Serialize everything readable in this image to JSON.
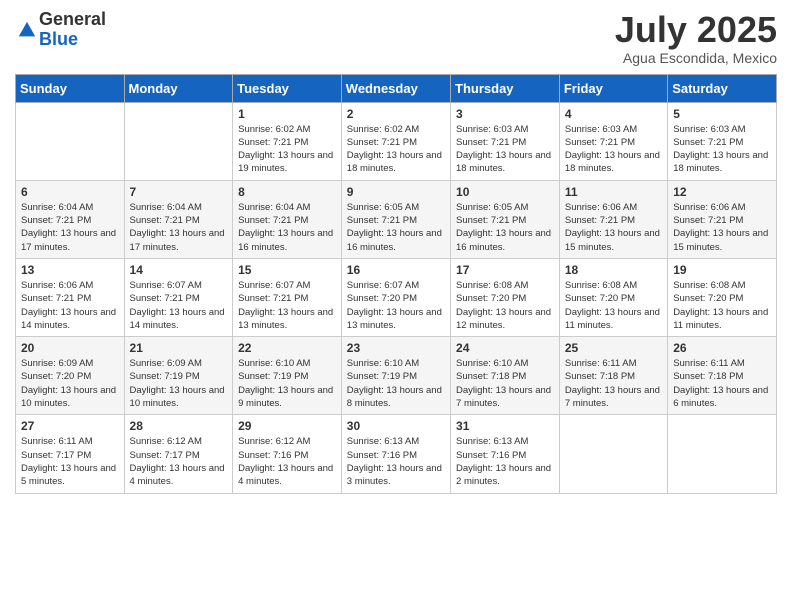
{
  "header": {
    "logo_general": "General",
    "logo_blue": "Blue",
    "month": "July 2025",
    "location": "Agua Escondida, Mexico"
  },
  "weekdays": [
    "Sunday",
    "Monday",
    "Tuesday",
    "Wednesday",
    "Thursday",
    "Friday",
    "Saturday"
  ],
  "weeks": [
    [
      {
        "day": "",
        "sunrise": "",
        "sunset": "",
        "daylight": ""
      },
      {
        "day": "",
        "sunrise": "",
        "sunset": "",
        "daylight": ""
      },
      {
        "day": "1",
        "sunrise": "Sunrise: 6:02 AM",
        "sunset": "Sunset: 7:21 PM",
        "daylight": "Daylight: 13 hours and 19 minutes."
      },
      {
        "day": "2",
        "sunrise": "Sunrise: 6:02 AM",
        "sunset": "Sunset: 7:21 PM",
        "daylight": "Daylight: 13 hours and 18 minutes."
      },
      {
        "day": "3",
        "sunrise": "Sunrise: 6:03 AM",
        "sunset": "Sunset: 7:21 PM",
        "daylight": "Daylight: 13 hours and 18 minutes."
      },
      {
        "day": "4",
        "sunrise": "Sunrise: 6:03 AM",
        "sunset": "Sunset: 7:21 PM",
        "daylight": "Daylight: 13 hours and 18 minutes."
      },
      {
        "day": "5",
        "sunrise": "Sunrise: 6:03 AM",
        "sunset": "Sunset: 7:21 PM",
        "daylight": "Daylight: 13 hours and 18 minutes."
      }
    ],
    [
      {
        "day": "6",
        "sunrise": "Sunrise: 6:04 AM",
        "sunset": "Sunset: 7:21 PM",
        "daylight": "Daylight: 13 hours and 17 minutes."
      },
      {
        "day": "7",
        "sunrise": "Sunrise: 6:04 AM",
        "sunset": "Sunset: 7:21 PM",
        "daylight": "Daylight: 13 hours and 17 minutes."
      },
      {
        "day": "8",
        "sunrise": "Sunrise: 6:04 AM",
        "sunset": "Sunset: 7:21 PM",
        "daylight": "Daylight: 13 hours and 16 minutes."
      },
      {
        "day": "9",
        "sunrise": "Sunrise: 6:05 AM",
        "sunset": "Sunset: 7:21 PM",
        "daylight": "Daylight: 13 hours and 16 minutes."
      },
      {
        "day": "10",
        "sunrise": "Sunrise: 6:05 AM",
        "sunset": "Sunset: 7:21 PM",
        "daylight": "Daylight: 13 hours and 16 minutes."
      },
      {
        "day": "11",
        "sunrise": "Sunrise: 6:06 AM",
        "sunset": "Sunset: 7:21 PM",
        "daylight": "Daylight: 13 hours and 15 minutes."
      },
      {
        "day": "12",
        "sunrise": "Sunrise: 6:06 AM",
        "sunset": "Sunset: 7:21 PM",
        "daylight": "Daylight: 13 hours and 15 minutes."
      }
    ],
    [
      {
        "day": "13",
        "sunrise": "Sunrise: 6:06 AM",
        "sunset": "Sunset: 7:21 PM",
        "daylight": "Daylight: 13 hours and 14 minutes."
      },
      {
        "day": "14",
        "sunrise": "Sunrise: 6:07 AM",
        "sunset": "Sunset: 7:21 PM",
        "daylight": "Daylight: 13 hours and 14 minutes."
      },
      {
        "day": "15",
        "sunrise": "Sunrise: 6:07 AM",
        "sunset": "Sunset: 7:21 PM",
        "daylight": "Daylight: 13 hours and 13 minutes."
      },
      {
        "day": "16",
        "sunrise": "Sunrise: 6:07 AM",
        "sunset": "Sunset: 7:20 PM",
        "daylight": "Daylight: 13 hours and 13 minutes."
      },
      {
        "day": "17",
        "sunrise": "Sunrise: 6:08 AM",
        "sunset": "Sunset: 7:20 PM",
        "daylight": "Daylight: 13 hours and 12 minutes."
      },
      {
        "day": "18",
        "sunrise": "Sunrise: 6:08 AM",
        "sunset": "Sunset: 7:20 PM",
        "daylight": "Daylight: 13 hours and 11 minutes."
      },
      {
        "day": "19",
        "sunrise": "Sunrise: 6:08 AM",
        "sunset": "Sunset: 7:20 PM",
        "daylight": "Daylight: 13 hours and 11 minutes."
      }
    ],
    [
      {
        "day": "20",
        "sunrise": "Sunrise: 6:09 AM",
        "sunset": "Sunset: 7:20 PM",
        "daylight": "Daylight: 13 hours and 10 minutes."
      },
      {
        "day": "21",
        "sunrise": "Sunrise: 6:09 AM",
        "sunset": "Sunset: 7:19 PM",
        "daylight": "Daylight: 13 hours and 10 minutes."
      },
      {
        "day": "22",
        "sunrise": "Sunrise: 6:10 AM",
        "sunset": "Sunset: 7:19 PM",
        "daylight": "Daylight: 13 hours and 9 minutes."
      },
      {
        "day": "23",
        "sunrise": "Sunrise: 6:10 AM",
        "sunset": "Sunset: 7:19 PM",
        "daylight": "Daylight: 13 hours and 8 minutes."
      },
      {
        "day": "24",
        "sunrise": "Sunrise: 6:10 AM",
        "sunset": "Sunset: 7:18 PM",
        "daylight": "Daylight: 13 hours and 7 minutes."
      },
      {
        "day": "25",
        "sunrise": "Sunrise: 6:11 AM",
        "sunset": "Sunset: 7:18 PM",
        "daylight": "Daylight: 13 hours and 7 minutes."
      },
      {
        "day": "26",
        "sunrise": "Sunrise: 6:11 AM",
        "sunset": "Sunset: 7:18 PM",
        "daylight": "Daylight: 13 hours and 6 minutes."
      }
    ],
    [
      {
        "day": "27",
        "sunrise": "Sunrise: 6:11 AM",
        "sunset": "Sunset: 7:17 PM",
        "daylight": "Daylight: 13 hours and 5 minutes."
      },
      {
        "day": "28",
        "sunrise": "Sunrise: 6:12 AM",
        "sunset": "Sunset: 7:17 PM",
        "daylight": "Daylight: 13 hours and 4 minutes."
      },
      {
        "day": "29",
        "sunrise": "Sunrise: 6:12 AM",
        "sunset": "Sunset: 7:16 PM",
        "daylight": "Daylight: 13 hours and 4 minutes."
      },
      {
        "day": "30",
        "sunrise": "Sunrise: 6:13 AM",
        "sunset": "Sunset: 7:16 PM",
        "daylight": "Daylight: 13 hours and 3 minutes."
      },
      {
        "day": "31",
        "sunrise": "Sunrise: 6:13 AM",
        "sunset": "Sunset: 7:16 PM",
        "daylight": "Daylight: 13 hours and 2 minutes."
      },
      {
        "day": "",
        "sunrise": "",
        "sunset": "",
        "daylight": ""
      },
      {
        "day": "",
        "sunrise": "",
        "sunset": "",
        "daylight": ""
      }
    ]
  ]
}
